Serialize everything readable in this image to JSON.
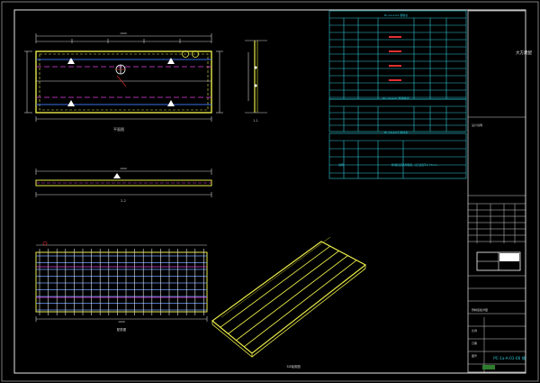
{
  "drawing": {
    "top_view_label": "平面图",
    "side_view_label": "1-1",
    "long_section_label": "2-2",
    "rebar_view_label": "配筋图",
    "iso_view_label": "3D轴测图",
    "dim_top_total": "1000",
    "dim_long_total": "1000",
    "dim_rebar_total": "1000"
  },
  "tables": {
    "rebar_table_title": "PC-1a-A-01 钢筋表",
    "rebar_table2_title": "PC-1a-A-01 预埋件表",
    "rebar_table3_title": "PC-1a-A-01 吊件表",
    "notes_title": "说明",
    "note_text": "预制板底面为粗糙面，凹凸深度不小于4mm"
  },
  "title_block": {
    "company_vertical": "大方建配",
    "notes_label": "设计说明",
    "drawing_label": "预制底板详图",
    "drawing_number": "PC-1a-A-01-06 钢",
    "scale_label": "比例",
    "date_label": "日期",
    "sheet_label": "图号"
  }
}
